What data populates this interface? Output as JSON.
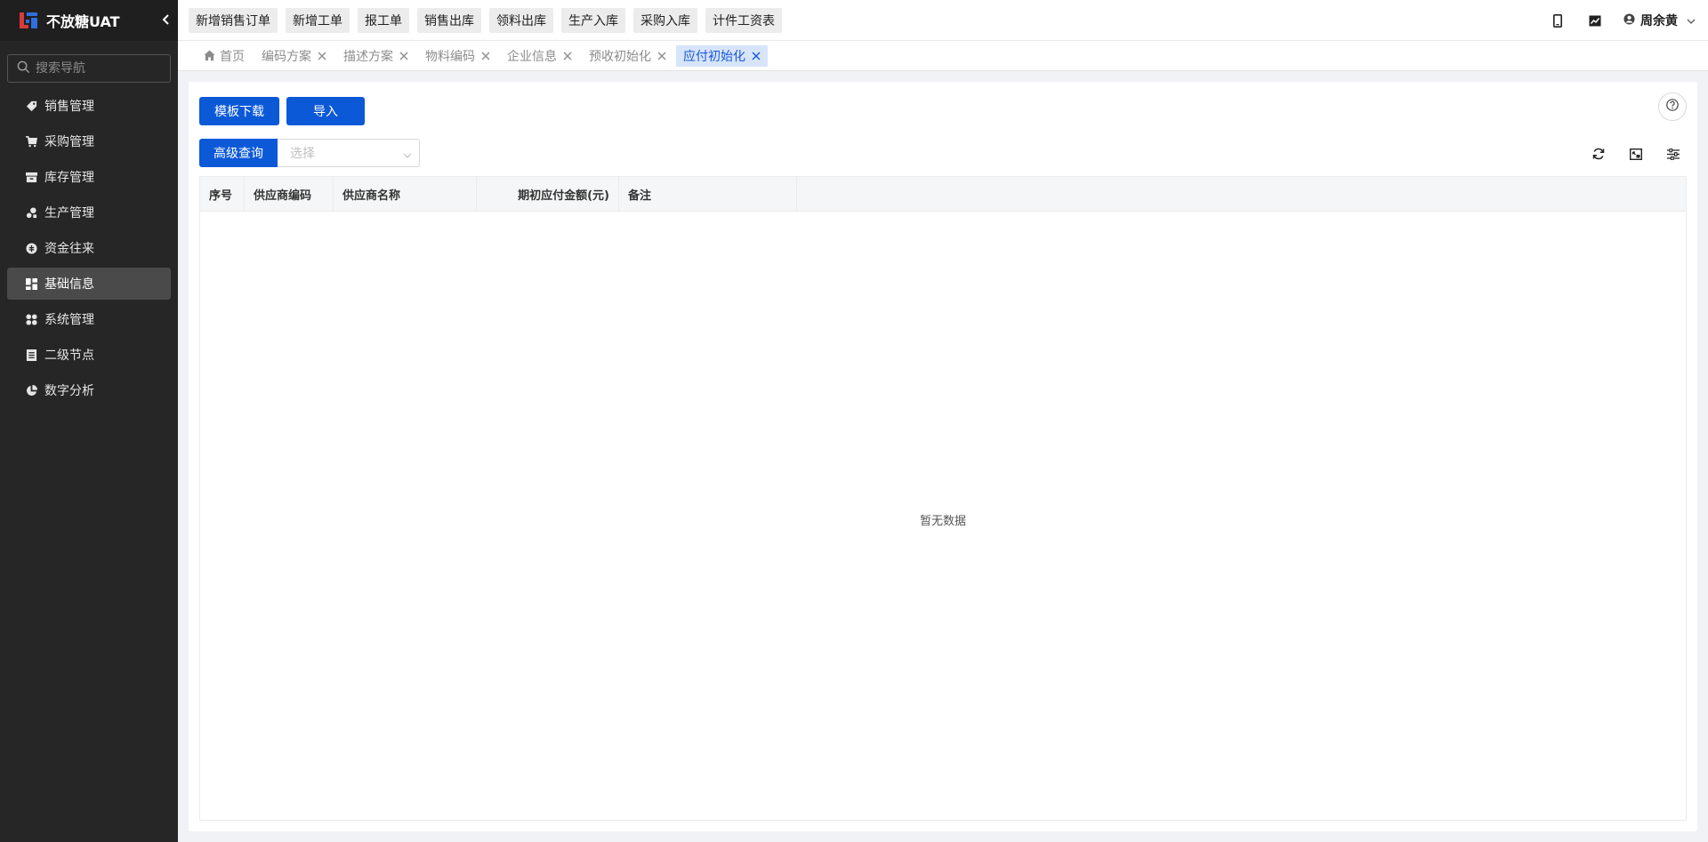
{
  "app": {
    "title": "不放糖UAT",
    "colors": {
      "sidebar_bg": "#262626",
      "primary": "#0c59d8",
      "tab_active_bg": "#d7e5fb"
    }
  },
  "sidebar": {
    "search_placeholder": "搜索导航",
    "items": [
      {
        "label": "销售管理",
        "icon": "tag-icon"
      },
      {
        "label": "采购管理",
        "icon": "cart-icon"
      },
      {
        "label": "库存管理",
        "icon": "inventory-icon"
      },
      {
        "label": "生产管理",
        "icon": "production-icon"
      },
      {
        "label": "资金往来",
        "icon": "fund-icon"
      },
      {
        "label": "基础信息",
        "icon": "dashboard-icon",
        "active": true
      },
      {
        "label": "系统管理",
        "icon": "apps-icon"
      },
      {
        "label": "二级节点",
        "icon": "document-icon"
      },
      {
        "label": "数字分析",
        "icon": "pie-chart-icon"
      }
    ]
  },
  "topbar": {
    "quick_actions": [
      "新增销售订单",
      "新增工单",
      "报工单",
      "销售出库",
      "领料出库",
      "生产入库",
      "采购入库",
      "计件工资表"
    ],
    "user_name": "周余黄"
  },
  "tabs": [
    {
      "label": "首页",
      "home": true
    },
    {
      "label": "编码方案",
      "closable": true
    },
    {
      "label": "描述方案",
      "closable": true
    },
    {
      "label": "物料编码",
      "closable": true
    },
    {
      "label": "企业信息",
      "closable": true
    },
    {
      "label": "预收初始化",
      "closable": true
    },
    {
      "label": "应付初始化",
      "closable": true,
      "active": true
    }
  ],
  "toolbar": {
    "template_download": "模板下载",
    "import": "导入",
    "advanced_query": "高级查询",
    "select_placeholder": "选择"
  },
  "table": {
    "columns": [
      "序号",
      "供应商编码",
      "供应商名称",
      "期初应付金额(元)",
      "备注"
    ],
    "empty_text": "暂无数据"
  }
}
